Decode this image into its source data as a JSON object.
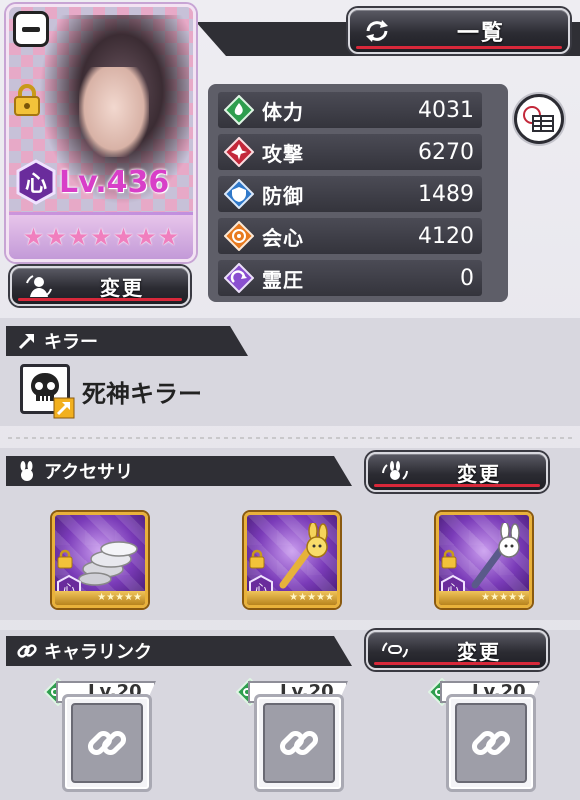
{
  "header": {
    "list_button_label": "一覧",
    "list_icon": "refresh-icon"
  },
  "character": {
    "level": "Lv.436",
    "attribute": "心",
    "stars": 7,
    "change_button_label": "変更",
    "locked": true
  },
  "stats": [
    {
      "label": "体力",
      "value": "4031",
      "icon": "hp-icon",
      "color": "#2e9e4e"
    },
    {
      "label": "攻撃",
      "value": "6270",
      "icon": "attack-icon",
      "color": "#c3283a"
    },
    {
      "label": "防御",
      "value": "1489",
      "icon": "defense-icon",
      "color": "#2f78c9"
    },
    {
      "label": "会心",
      "value": "4120",
      "icon": "critical-icon",
      "color": "#e87a1e"
    },
    {
      "label": "霊圧",
      "value": "0",
      "icon": "spirit-icon",
      "color": "#8a4fd0"
    }
  ],
  "killer": {
    "section_title": "キラー",
    "name": "死神キラー",
    "icon": "skull-icon"
  },
  "accessory": {
    "section_title": "アクセサリ",
    "change_button_label": "変更",
    "items": [
      {
        "name": "coins-accessory",
        "attribute": "心",
        "stars": 5
      },
      {
        "name": "rabbit-wand-gold",
        "attribute": "心",
        "stars": 5
      },
      {
        "name": "rabbit-wand-silver",
        "attribute": "心",
        "stars": 5
      }
    ]
  },
  "chara_link": {
    "section_title": "キャラリンク",
    "change_button_label": "変更",
    "slots": [
      {
        "level": "Lv.20"
      },
      {
        "level": "Lv.20"
      },
      {
        "level": "Lv.20"
      }
    ]
  },
  "colors": {
    "accent_red": "#d8283a",
    "dark_panel": "#2f2f35",
    "level_pink": "#d83fc8",
    "gold_frame": "#e9b23b"
  }
}
